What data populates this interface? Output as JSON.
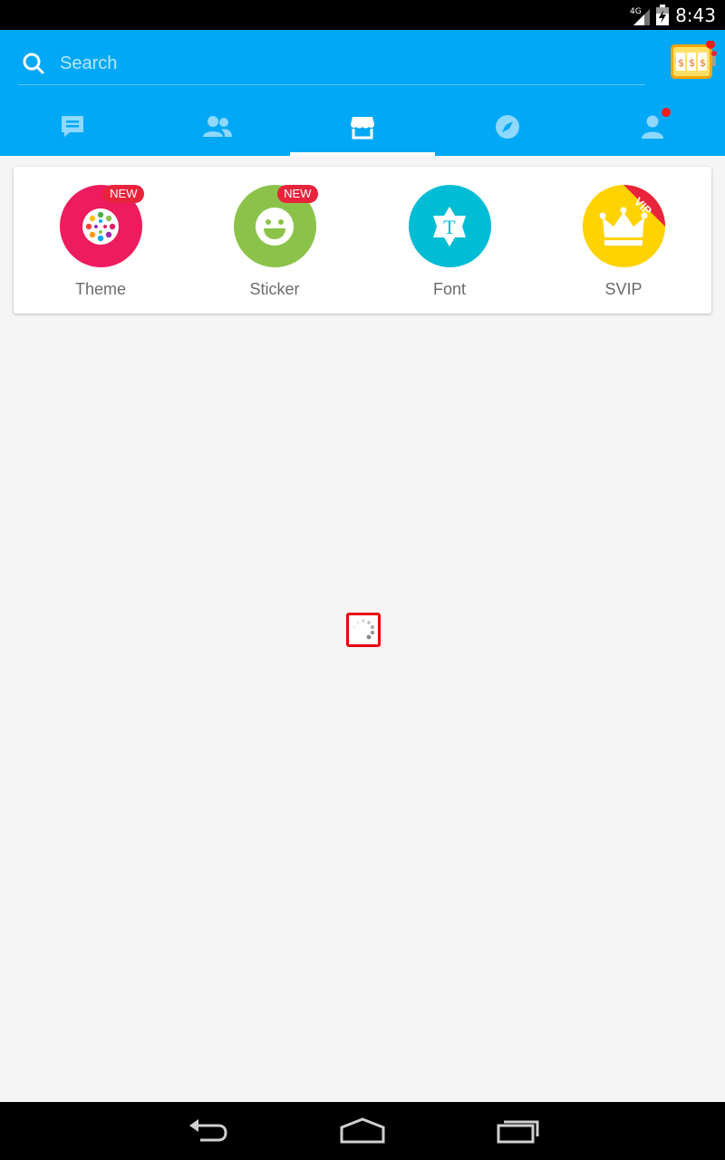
{
  "status_bar": {
    "network": "4G",
    "time": "8:43"
  },
  "search": {
    "placeholder": "Search"
  },
  "header": {
    "slot_icon": "slot-machine-icon",
    "tabs": [
      {
        "icon": "chat-icon",
        "active": false
      },
      {
        "icon": "contacts-icon",
        "active": false
      },
      {
        "icon": "store-icon",
        "active": true
      },
      {
        "icon": "compass-icon",
        "active": false
      },
      {
        "icon": "profile-icon",
        "active": false,
        "notification": true
      }
    ]
  },
  "features": [
    {
      "label": "Theme",
      "badge": "NEW",
      "color": "#ec1c5e",
      "icon": "theme-icon"
    },
    {
      "label": "Sticker",
      "badge": "NEW",
      "color": "#8bc34a",
      "icon": "sticker-icon"
    },
    {
      "label": "Font",
      "badge": "",
      "color": "#00bcd4",
      "icon": "font-icon"
    },
    {
      "label": "SVIP",
      "ribbon": "VIP",
      "color": "#ffd200",
      "icon": "crown-icon"
    }
  ],
  "colors": {
    "header": "#00a8f5",
    "background": "#f5f5f5",
    "badge": "#e8243c"
  }
}
